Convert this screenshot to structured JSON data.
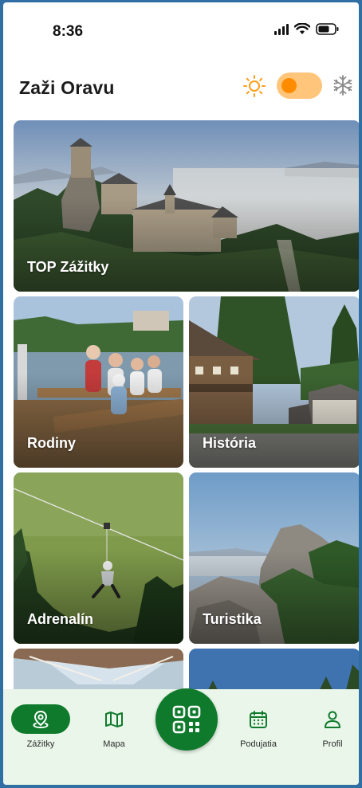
{
  "status_bar": {
    "time": "8:36"
  },
  "header": {
    "title": "Zaži Oravu",
    "season_toggle": {
      "left_icon": "sun-icon",
      "right_icon": "snowflake-icon",
      "accent_color": "#ff8c00",
      "track_color": "#ffc57a"
    }
  },
  "categories": [
    {
      "label": "TOP Zážitky"
    },
    {
      "label": "Rodiny"
    },
    {
      "label": "História"
    },
    {
      "label": "Adrenalín"
    },
    {
      "label": "Turistika"
    }
  ],
  "bottom_nav": {
    "items": [
      {
        "label": "Zážitky",
        "icon": "location-pin-icon",
        "active": true
      },
      {
        "label": "Mapa",
        "icon": "map-icon",
        "active": false
      },
      {
        "label": "Podujatia",
        "icon": "calendar-icon",
        "active": false
      },
      {
        "label": "Profil",
        "icon": "user-icon",
        "active": false
      }
    ],
    "center_button": {
      "icon": "qr-code-icon"
    },
    "brand_color": "#0f7a2c",
    "background": "#eaf6ea"
  }
}
